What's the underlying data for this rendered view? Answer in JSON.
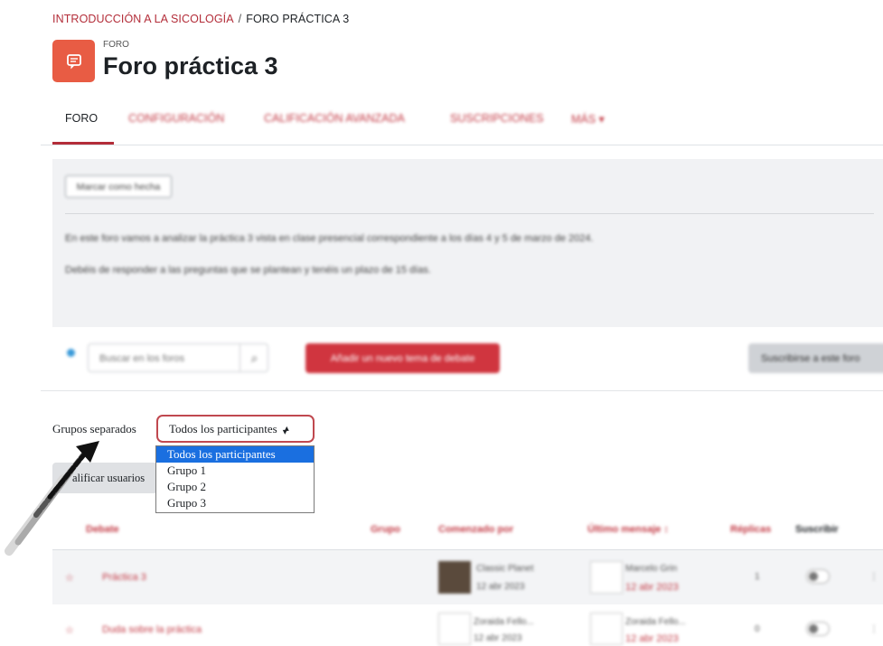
{
  "breadcrumb": {
    "course": "INTRODUCCIÓN A LA SICOLOGÍA",
    "separator": "/",
    "current": "FORO PRÁCTICA 3"
  },
  "header": {
    "type_label": "FORO",
    "title": "Foro práctica 3",
    "icon": "forum-icon",
    "icon_color": "#e85c44"
  },
  "tabs": [
    {
      "label": "FORO",
      "active": true
    },
    {
      "label": "CONFIGURACIÓN"
    },
    {
      "label": "CALIFICACIÓN AVANZADA"
    },
    {
      "label": "SUSCRIPCIONES"
    },
    {
      "label": "MÁS ▾"
    }
  ],
  "description": {
    "mark_done_label": "Marcar como hecha",
    "line1": "En este foro vamos a analizar la práctica 3 vista en clase presencial correspondiente a los días 4 y 5 de marzo de 2024.",
    "line2": "Debéis de responder a las preguntas que se plantean y tenéis un plazo de 15 días."
  },
  "toolbar": {
    "search_placeholder": "Buscar en los foros",
    "add_topic_label": "Añadir un nuevo tema de debate",
    "subscribe_label": "Suscribirse a este foro"
  },
  "groups": {
    "label": "Grupos separados",
    "selected": "Todos los participantes",
    "options": [
      "Todos los participantes",
      "Grupo 1",
      "Grupo 2",
      "Grupo 3"
    ]
  },
  "califica_label": "alificar usuarios",
  "table": {
    "headers": [
      "Debate",
      "Grupo",
      "Comenzado por",
      "Último mensaje ↕",
      "Réplicas",
      "Suscribir"
    ],
    "rows": [
      {
        "title": "Práctica 3",
        "started_by": "Classic Planet",
        "started_date": "12 abr 2023",
        "last_by": "Marcelo Grin",
        "last_date": "12 abr 2023",
        "replies": "1"
      },
      {
        "title": "Duda sobre la práctica",
        "started_by": "Zoraida Fello...",
        "started_date": "12 abr 2023",
        "last_by": "Zoraida Fello...",
        "last_date": "12 abr 2023",
        "replies": "0"
      }
    ]
  },
  "colors": {
    "accent": "#b32d39",
    "button_red": "#d0353f",
    "selection_blue": "#1a6fe0"
  }
}
